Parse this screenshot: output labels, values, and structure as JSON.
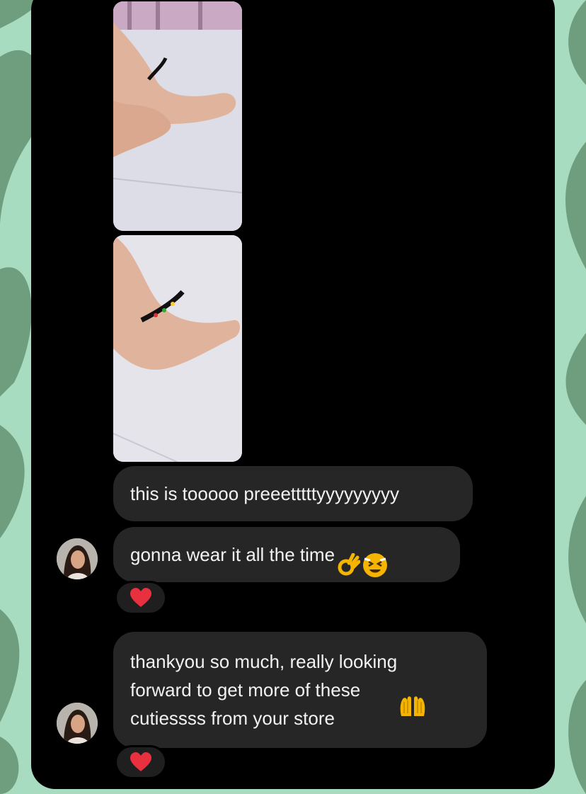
{
  "colors": {
    "background_light": "#a8dcc0",
    "background_dark": "#6e9e7d",
    "panel": "#000000",
    "bubble": "#262626",
    "bubble_text": "#f2f2f2",
    "reaction_heart": "#e8303f"
  },
  "messages": [
    {
      "type": "image",
      "content": "photo of foot wearing black beaded anklet (standing)"
    },
    {
      "type": "image",
      "content": "photo of foot wearing black beaded anklet (close up)"
    },
    {
      "type": "text",
      "text": "this is tooooo preeetttttyyyyyyyyy"
    },
    {
      "type": "text",
      "text": "gonna wear it all the time",
      "emojis": [
        "ok-hand-icon",
        "blushing-laughing-face-icon"
      ]
    },
    {
      "type": "text",
      "text": "thankyou so much, really looking\nforward to get more of these\ncutiessss from your store",
      "emojis": [
        "palms-together-icon"
      ]
    }
  ],
  "reactions": [
    {
      "icon": "heart-icon"
    },
    {
      "icon": "heart-icon"
    }
  ]
}
